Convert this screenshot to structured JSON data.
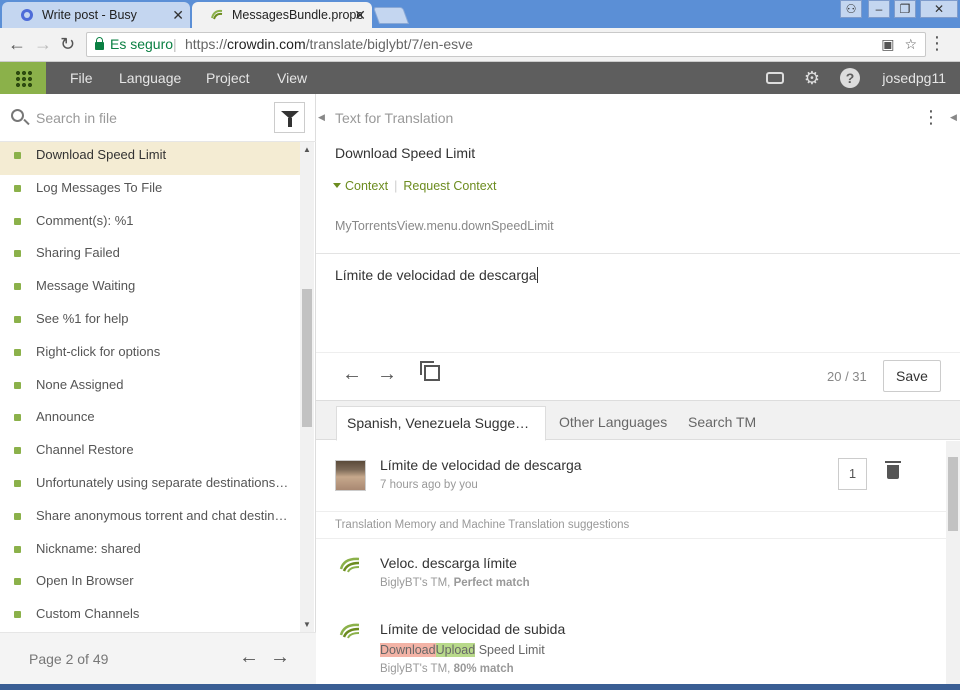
{
  "browser": {
    "tabs": [
      {
        "title": "Write post - Busy",
        "active": false
      },
      {
        "title": "MessagesBundle.properti",
        "active": true
      }
    ],
    "secure_label": "Es seguro",
    "url_scheme": "https://",
    "url_host": "crowdin.com",
    "url_path": "/translate/biglybt/7/en-esve",
    "window_controls": [
      "profile",
      "minimize",
      "restore",
      "close"
    ]
  },
  "appbar": {
    "menu": [
      "File",
      "Language",
      "Project",
      "View"
    ],
    "icons": [
      "grid-icon",
      "keyboard-icon",
      "gear-icon",
      "help-icon"
    ],
    "username": "josedpg11",
    "accent": "#8bb14a"
  },
  "sidebar": {
    "search_placeholder": "Search in file",
    "strings": [
      "Download Speed Limit",
      "Log Messages To File",
      "Comment(s): %1",
      "Sharing Failed",
      "Message Waiting",
      "See %1 for help",
      "Right-click for options",
      "None Assigned",
      "Announce",
      "Channel Restore",
      "Unfortunately using separate destinations for torrent and chat",
      "Share anonymous torrent and chat destinations",
      "Nickname: shared",
      "Open In Browser",
      "Custom Channels"
    ],
    "active_index": 0,
    "page_label": "Page 2 of 49"
  },
  "editor": {
    "source_header": "Text for Translation",
    "source_text": "Download Speed Limit",
    "context_label": "Context",
    "request_context_label": "Request Context",
    "key": "MyTorrentsView.menu.downSpeedLimit",
    "translation": "Límite de velocidad de descarga",
    "counter": "20 / 31",
    "save_label": "Save"
  },
  "suggestions": {
    "tabs": [
      "Spanish, Venezuela Suggestions",
      "Other Languages",
      "Search TM"
    ],
    "own": {
      "text": "Límite de velocidad de descarga",
      "meta": "7 hours ago by you",
      "votes": "1"
    },
    "tm_header": "Translation Memory and Machine Translation suggestions",
    "tm_items": [
      {
        "text": "Veloc. descarga límite",
        "source_name": "BiglyBT's TM, ",
        "match": "Perfect match"
      },
      {
        "text": "Límite de velocidad de subida",
        "diff_del": "Download",
        "diff_ins": "Upload",
        "diff_rest": " Speed Limit",
        "source_name": "BiglyBT's TM, ",
        "match": "80% match"
      }
    ]
  }
}
